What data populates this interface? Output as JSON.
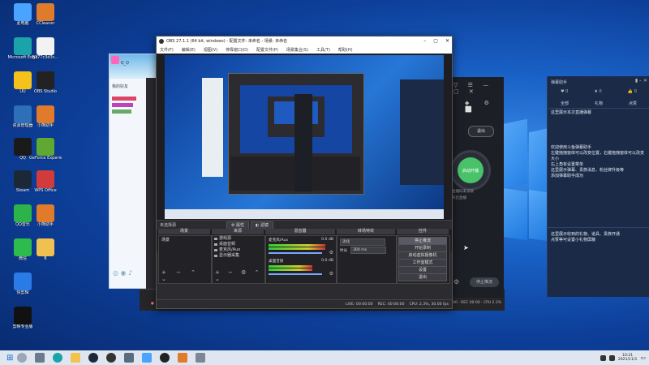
{
  "desktop_icons": [
    {
      "label": "此电脑",
      "icon": "computer-icon",
      "color": "#4aa3ff"
    },
    {
      "label": "CCleaner",
      "icon": "app-icon",
      "color": "#e07b2c"
    },
    {
      "label": "Microsoft Edge",
      "icon": "edge-icon",
      "color": "#1aa3a8"
    },
    {
      "label": "8377c3d3c...",
      "icon": "file-icon",
      "color": "#f2f2f2"
    },
    {
      "label": "UU",
      "icon": "uu-icon",
      "color": "#f4c21b"
    },
    {
      "label": "OBS Studio",
      "icon": "obs-icon",
      "color": "#222222"
    },
    {
      "label": "资源管理器",
      "icon": "settings-icon",
      "color": "#2f6fb8"
    },
    {
      "label": "小熊助手",
      "icon": "app-icon",
      "color": "#e07b2c"
    },
    {
      "label": "QQ",
      "icon": "qq-icon",
      "color": "#1a1a1a"
    },
    {
      "label": "GeForce Experience",
      "icon": "nvidia-icon",
      "color": "#5fa832"
    },
    {
      "label": "Steam",
      "icon": "steam-icon",
      "color": "#1b2838"
    },
    {
      "label": "WPS Office",
      "icon": "wps-icon",
      "color": "#d23b3b"
    },
    {
      "label": "QQ音乐",
      "icon": "music-icon",
      "color": "#2cb34a"
    },
    {
      "label": "小熊助手",
      "icon": "app-icon",
      "color": "#e07b2c"
    },
    {
      "label": "微信",
      "icon": "wechat-icon",
      "color": "#2dbb4e"
    },
    {
      "label": "B",
      "icon": "file-icon",
      "color": "#f0c050"
    },
    {
      "label": "快剪辑",
      "icon": "kuaijian-icon",
      "color": "#2a7be8"
    },
    {
      "label": "剪映专业版",
      "icon": "capcut-icon",
      "color": "#111111"
    }
  ],
  "obs": {
    "title": "OBS 27.1.1 (64 bit, windows) - 配置文件: 未命名 - 场景: 未命名",
    "menu": [
      "文件(F)",
      "编辑(E)",
      "视图(V)",
      "停靠窗口(D)",
      "配置文件(P)",
      "场景集合(S)",
      "工具(T)",
      "帮助(H)"
    ],
    "source_bar": "未选择源",
    "props_button": "属性",
    "filters_button": "滤镜",
    "docks": {
      "scenes": {
        "title": "场景",
        "items": [
          "场景"
        ]
      },
      "sources": {
        "title": "来源",
        "items": [
          "游戏源",
          "桌面音频",
          "麦克风/Aux",
          "显示器采集"
        ]
      },
      "mixer": {
        "title": "混音器",
        "channels": [
          {
            "name": "麦克风/Aux",
            "db": "0.0 dB"
          },
          {
            "name": "桌面音频",
            "db": "0.0 dB"
          }
        ]
      },
      "transitions": {
        "title": "转场特效",
        "type": "淡化",
        "duration_label": "时长",
        "duration": "300 ms"
      },
      "controls": {
        "title": "控件",
        "buttons": [
          "停止推流",
          "开始录制",
          "启动虚拟摄像机",
          "工作室模式",
          "设置",
          "退出"
        ]
      }
    },
    "status": {
      "live": "LIVE: 00:00:00",
      "rec": "REC: 00:00:00",
      "cpu": "CPU: 2.3%, 30.00 fps"
    }
  },
  "qq_window": {
    "title": "Q_Q",
    "group": "我的好友"
  },
  "dark_panel": {
    "button": "退出",
    "circle_label": "启动开播",
    "note1": "直播码未读取",
    "note2": "开启直播",
    "bottom_button": "停止推流"
  },
  "assistant": {
    "title": "弹幕助手",
    "stats": [
      {
        "icon": "heart-icon",
        "value": "0"
      },
      {
        "icon": "gift-icon",
        "value": "0"
      },
      {
        "icon": "like-icon",
        "value": "0"
      }
    ],
    "tabs": [
      "全部",
      "礼物",
      "点赞"
    ],
    "lines": [
      "这里展示本次直播弹幕",
      "欢迎使用斗鱼弹幕助手",
      "左键拖拽窗体可以改变位置，右键拖拽窗体可以改变大小",
      "右上角有设置菜单",
      "这里展示弹幕、贵族消息、粉丝牌升级等",
      "添加弹幕助手成功"
    ],
    "lines2": [
      "这里展示收到的礼物、道具、贵族开通",
      "点赞等可设置小礼物屏蔽"
    ]
  },
  "taskbar": {
    "time": "10:21",
    "date": "2021/11/1"
  }
}
